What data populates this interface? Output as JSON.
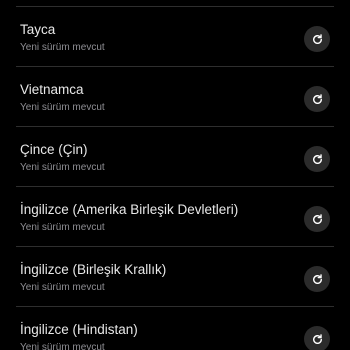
{
  "languages": [
    {
      "name": "Tayca",
      "status": "Yeni sürüm mevcut",
      "action_icon": "refresh-icon"
    },
    {
      "name": "Vietnamca",
      "status": "Yeni sürüm mevcut",
      "action_icon": "refresh-icon"
    },
    {
      "name": "Çince (Çin)",
      "status": "Yeni sürüm mevcut",
      "action_icon": "refresh-icon"
    },
    {
      "name": "İngilizce (Amerika Birleşik Devletleri)",
      "status": "Yeni sürüm mevcut",
      "action_icon": "refresh-icon"
    },
    {
      "name": "İngilizce (Birleşik Krallık)",
      "status": "Yeni sürüm mevcut",
      "action_icon": "refresh-icon"
    },
    {
      "name": "İngilizce (Hindistan)",
      "status": "Yeni sürüm mevcut",
      "action_icon": "refresh-icon"
    }
  ],
  "colors": {
    "background": "#000000",
    "primary_text": "#e8e8e8",
    "secondary_text": "#8e8e93",
    "button_background": "#2b2b2b",
    "divider": "#2e2e2e"
  }
}
